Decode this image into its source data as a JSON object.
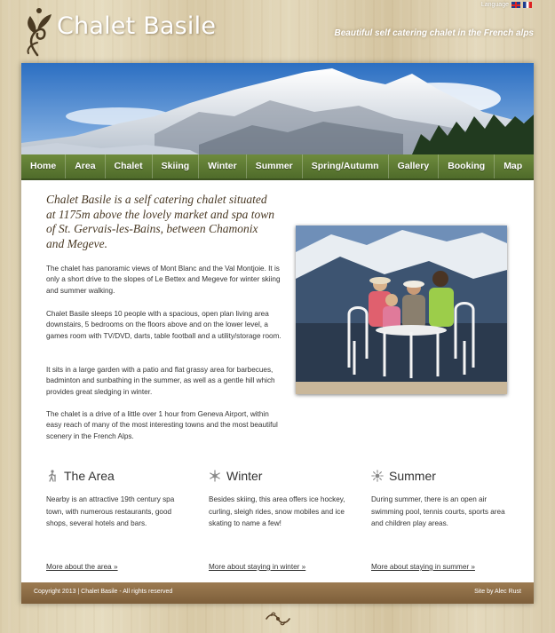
{
  "header": {
    "site_title": "Chalet Basile",
    "tagline": "Beautiful self catering chalet in the French alps",
    "language_label": "Language"
  },
  "nav": {
    "items": [
      "Home",
      "Area",
      "Chalet",
      "Skiing",
      "Winter",
      "Summer",
      "Spring/Autumn",
      "Gallery",
      "Booking",
      "Map"
    ]
  },
  "main": {
    "intro": "Chalet Basile is a self catering chalet situated at 1175m above the lovely market and spa town of St. Gervais-les-Bains, between Chamonix and Megeve.",
    "paragraphs": [
      "The chalet has panoramic views of Mont Blanc and the Val Montjoie. It is only a short drive to the slopes of Le Bettex and Megeve for winter skiing and summer walking.",
      "Chalet Basile sleeps 10 people with a spacious, open plan living area downstairs, 5 bedrooms on the floors above and on the lower level, a games room with TV/DVD, darts, table football and a utility/storage room.",
      "It sits in a large garden with a patio and flat grassy area for barbecues, badminton and sunbathing in the summer, as well as a gentle hill which provides great sledging in winter.",
      "The chalet is a drive of a little over 1 hour from Geneva Airport, within easy reach of many of the most interesting towns and the most beautiful scenery in the French Alps."
    ]
  },
  "columns": [
    {
      "title": "The Area",
      "icon": "walker-icon",
      "text": "Nearby is an attractive 19th century spa town, with numerous restaurants, good shops, several hotels and bars.",
      "link": "More about the area »"
    },
    {
      "title": "Winter",
      "icon": "snowflake-icon",
      "text": "Besides skiing, this area offers ice hockey, curling, sleigh rides, snow mobiles and ice skating to name a few!",
      "link": "More about staying in winter »"
    },
    {
      "title": "Summer",
      "icon": "sun-icon",
      "text": "During summer, there is an open air swimming pool, tennis courts, sports area and children play areas.",
      "link": "More about staying in summer »"
    }
  ],
  "footer": {
    "copyright": "Copyright 2013 | Chalet Basile - All rights reserved",
    "credit": "Site by Alec Rust"
  },
  "colors": {
    "nav_green": "#5d7a33",
    "footer_brown": "#8c6c45",
    "wood_background": "#ddd0b0"
  }
}
